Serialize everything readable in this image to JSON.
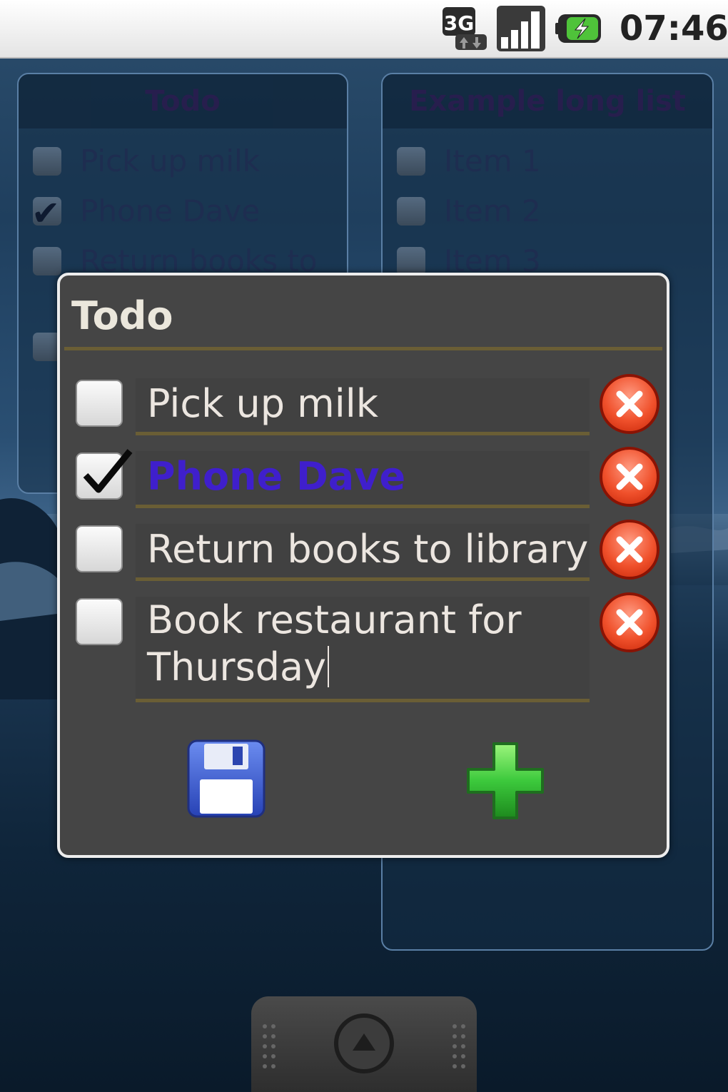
{
  "status_bar": {
    "network_icon": "3g-data-icon",
    "network_label": "3G",
    "signal_icon": "signal-strength-icon",
    "battery_icon": "battery-charging-icon",
    "time": "07:46"
  },
  "background_widgets": {
    "left": {
      "title": "Todo",
      "items": [
        {
          "label": "Pick up milk",
          "checked": false
        },
        {
          "label": "Phone Dave",
          "checked": true
        },
        {
          "label": "Return books to",
          "checked": false
        }
      ]
    },
    "right": {
      "title": "Example long list",
      "items": [
        {
          "label": "Item 1",
          "checked": false
        },
        {
          "label": "Item 2",
          "checked": false
        },
        {
          "label": "Item 3",
          "checked": false
        }
      ]
    }
  },
  "dialog": {
    "title": "Todo",
    "items": [
      {
        "text": "Pick up milk",
        "checked": false,
        "delete_icon": "delete-x-icon"
      },
      {
        "text": "Phone Dave",
        "checked": true,
        "delete_icon": "delete-x-icon"
      },
      {
        "text": "Return books to library",
        "checked": false,
        "delete_icon": "delete-x-icon"
      },
      {
        "text": "Book restaurant for Thursday",
        "checked": false,
        "delete_icon": "delete-x-icon"
      }
    ],
    "save_icon": "floppy-disk-save-icon",
    "add_icon": "green-plus-add-icon"
  },
  "dock": {
    "launcher_icon": "app-drawer-up-arrow-icon"
  },
  "colors": {
    "dialog_bg": "#454545",
    "divider": "#6a5e35",
    "done_text": "#3f1fcc",
    "delete_red": "#f0512c",
    "add_green": "#3cc93c",
    "save_blue": "#3553c7"
  }
}
